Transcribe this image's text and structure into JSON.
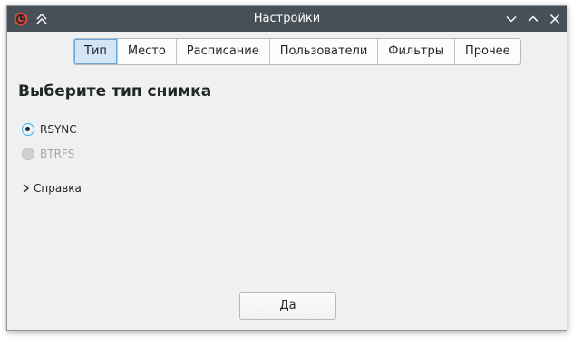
{
  "window": {
    "title": "Настройки"
  },
  "tabs": [
    {
      "label": "Тип",
      "active": true
    },
    {
      "label": "Место",
      "active": false
    },
    {
      "label": "Расписание",
      "active": false
    },
    {
      "label": "Пользователи",
      "active": false
    },
    {
      "label": "Фильтры",
      "active": false
    },
    {
      "label": "Прочее",
      "active": false
    }
  ],
  "main": {
    "heading": "Выберите тип снимка",
    "options": [
      {
        "label": "RSYNC",
        "checked": true,
        "enabled": true
      },
      {
        "label": "BTRFS",
        "checked": false,
        "enabled": false
      }
    ],
    "help_label": "Справка",
    "ok_label": "Да"
  },
  "icons": {
    "app": "timeshift-app-icon",
    "keep_above": "keep-above-icon",
    "minimize": "chevron-down-icon",
    "maximize": "chevron-up-icon",
    "close": "close-icon",
    "expander": "chevron-right-icon"
  },
  "colors": {
    "titlebar": "#475057",
    "window_bg": "#eff0f1",
    "accent": "#3daee9",
    "active_tab": "#d4e6f5",
    "app_icon": "#e0453a"
  }
}
